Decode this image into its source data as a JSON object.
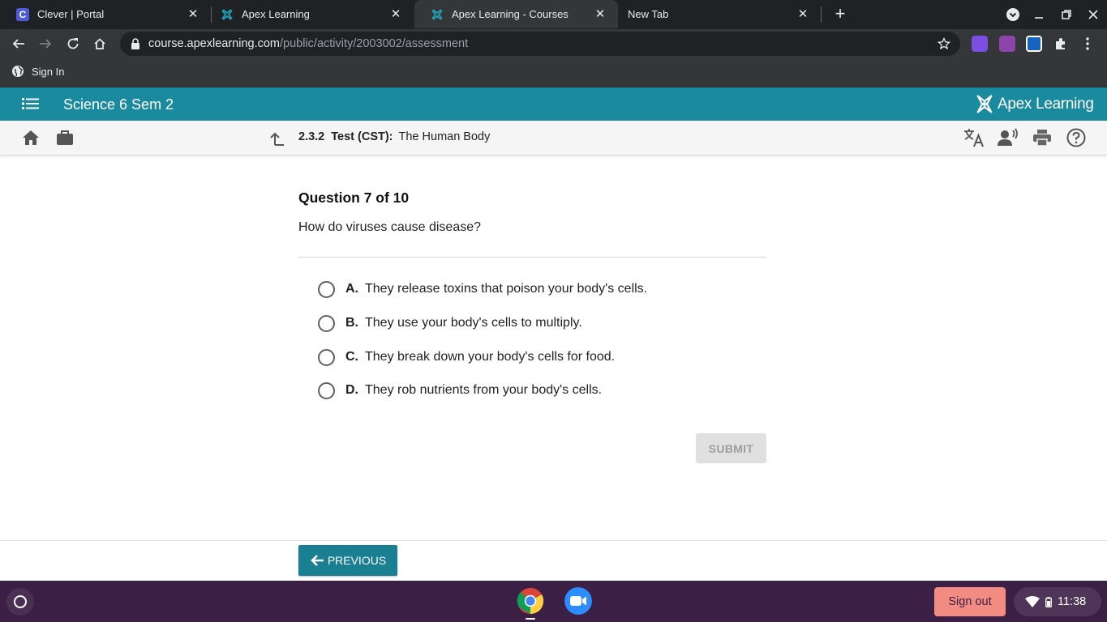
{
  "browser": {
    "tabs": [
      {
        "title": "Clever | Portal",
        "favicon": "clever-icon",
        "favicon_letter": "C",
        "active": false
      },
      {
        "title": "Apex Learning",
        "favicon": "apex-favicon",
        "active": false
      },
      {
        "title": "Apex Learning - Courses",
        "favicon": "apex-favicon",
        "active": true
      },
      {
        "title": "New Tab",
        "favicon": "",
        "active": false
      }
    ],
    "url": {
      "domain": "course.apexlearning.com",
      "path": "/public/activity/2003002/assessment"
    },
    "bookmarks": [
      {
        "label": "Sign In",
        "icon": "globe-icon"
      }
    ]
  },
  "app": {
    "course_title": "Science 6 Sem 2",
    "logo_text": "Apex Learning",
    "brand_color": "#1a8a9f"
  },
  "breadcrumb": {
    "number": "2.3.2",
    "type": "Test (CST):",
    "title": "The Human Body"
  },
  "question": {
    "heading": "Question 7 of 10",
    "text": "How do viruses cause disease?",
    "options": [
      {
        "letter": "A.",
        "text": "They release toxins that poison your body's cells."
      },
      {
        "letter": "B.",
        "text": "They use your body's cells to multiply."
      },
      {
        "letter": "C.",
        "text": "They break down your body's cells for food."
      },
      {
        "letter": "D.",
        "text": "They rob nutrients from your body's cells."
      }
    ],
    "submit_label": "SUBMIT"
  },
  "footer": {
    "previous_label": "PREVIOUS"
  },
  "shelf": {
    "signout_label": "Sign out",
    "time": "11:38"
  }
}
